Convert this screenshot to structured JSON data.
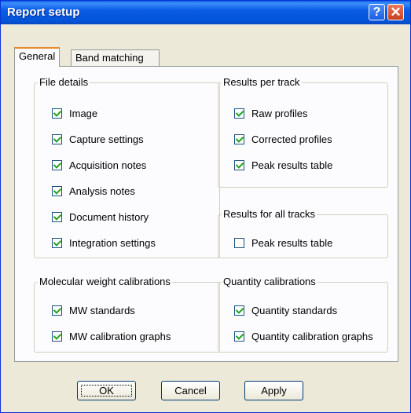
{
  "window": {
    "title": "Report setup",
    "help_glyph": "?",
    "close_glyph": "✕"
  },
  "tabs": [
    {
      "label": "General",
      "selected": true
    },
    {
      "label": "Band matching",
      "selected": false
    }
  ],
  "groups": {
    "file_details": {
      "label": "File details",
      "items": [
        {
          "label": "Image",
          "checked": true
        },
        {
          "label": "Capture settings",
          "checked": true
        },
        {
          "label": "Acquisition notes",
          "checked": true
        },
        {
          "label": "Analysis notes",
          "checked": true
        },
        {
          "label": "Document history",
          "checked": true
        },
        {
          "label": "Integration settings",
          "checked": true
        }
      ]
    },
    "results_per_track": {
      "label": "Results per track",
      "items": [
        {
          "label": "Raw profiles",
          "checked": true
        },
        {
          "label": "Corrected profiles",
          "checked": true
        },
        {
          "label": "Peak results table",
          "checked": true
        }
      ]
    },
    "results_all_tracks": {
      "label": "Results for all tracks",
      "items": [
        {
          "label": "Peak results table",
          "checked": false
        }
      ]
    },
    "mw_calibrations": {
      "label": "Molecular weight calibrations",
      "items": [
        {
          "label": "MW standards",
          "checked": true
        },
        {
          "label": "MW calibration graphs",
          "checked": true
        }
      ]
    },
    "quantity_calibrations": {
      "label": "Quantity calibrations",
      "items": [
        {
          "label": "Quantity standards",
          "checked": true
        },
        {
          "label": "Quantity calibration graphs",
          "checked": true
        }
      ]
    }
  },
  "buttons": {
    "ok": "OK",
    "cancel": "Cancel",
    "apply": "Apply"
  },
  "colors": {
    "titlebar": "#0a5ce4",
    "face": "#ece9d8",
    "check": "#21a121"
  }
}
